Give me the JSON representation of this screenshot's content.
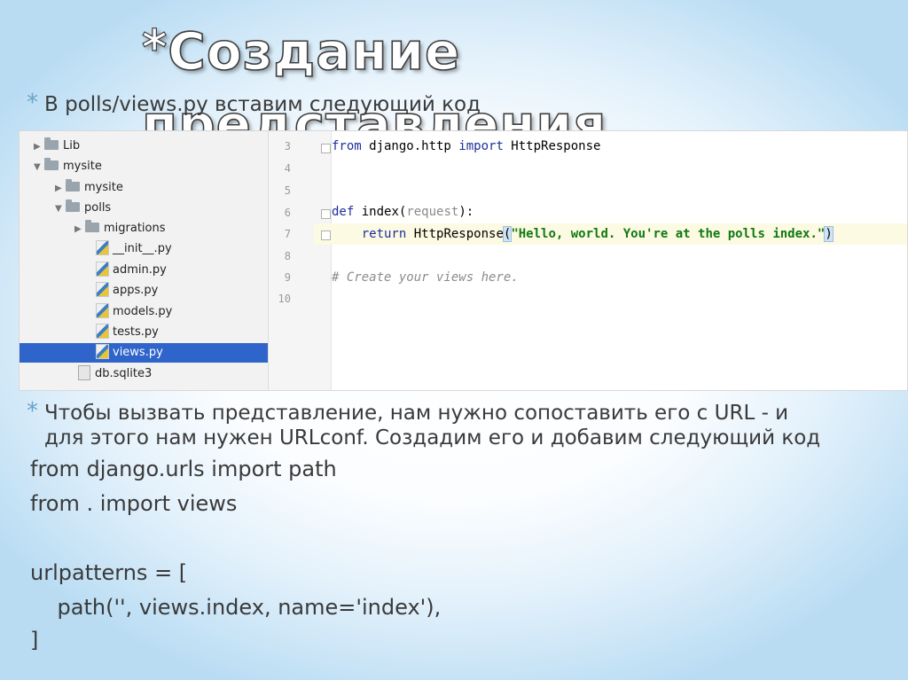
{
  "slide": {
    "title": "Создание представления",
    "title_star": "*",
    "bullet1": "В polls/views.py вставим следующий код",
    "bullet2_line1": "Чтобы вызвать представление, нам нужно сопоставить его с URL - и",
    "bullet2_line2": "для этого нам нужен URLconf. Создадим его и добавим следующий код",
    "bullet_star": "*",
    "code_lines": [
      "from django.urls import path",
      "from . import views",
      "",
      "urlpatterns = [",
      "    path('', views.index, name='index'),",
      "]"
    ]
  },
  "ide": {
    "tree": [
      {
        "label": "Lib",
        "arrow": "▶",
        "icon": "folder-icon",
        "depth": 0
      },
      {
        "label": "mysite",
        "arrow": "▼",
        "icon": "folder-icon",
        "depth": 0
      },
      {
        "label": "mysite",
        "arrow": "▶",
        "icon": "folder-icon",
        "depth": 1
      },
      {
        "label": "polls",
        "arrow": "▼",
        "icon": "folder-icon",
        "depth": 1
      },
      {
        "label": "migrations",
        "arrow": "▶",
        "icon": "folder-icon",
        "depth": 2
      },
      {
        "label": "__init__.py",
        "arrow": "",
        "icon": "python-file-icon",
        "depth": 2
      },
      {
        "label": "admin.py",
        "arrow": "",
        "icon": "python-file-icon",
        "depth": 2
      },
      {
        "label": "apps.py",
        "arrow": "",
        "icon": "python-file-icon",
        "depth": 2
      },
      {
        "label": "models.py",
        "arrow": "",
        "icon": "python-file-icon",
        "depth": 2
      },
      {
        "label": "tests.py",
        "arrow": "",
        "icon": "python-file-icon",
        "depth": 2
      },
      {
        "label": "views.py",
        "arrow": "",
        "icon": "python-file-icon",
        "depth": 2,
        "selected": true
      },
      {
        "label": "db.sqlite3",
        "arrow": "",
        "icon": "database-file-icon",
        "depth": 1
      }
    ],
    "line_numbers": [
      "3",
      "4",
      "5",
      "6",
      "7",
      "8",
      "9",
      "10"
    ],
    "code": {
      "l3_kw1": "from",
      "l3_mod": " django.http ",
      "l3_kw2": "import",
      "l3_name": " HttpResponse",
      "l6_kw": "def",
      "l6_fn": " index(",
      "l6_param": "request",
      "l6_end": "):",
      "l7_indent": "    ",
      "l7_kw": "return",
      "l7_call": " HttpResponse",
      "l7_open": "(",
      "l7_str": "\"Hello, world. You're at the polls index.\"",
      "l7_close": ")",
      "l9_comment": "# Create your views here."
    },
    "colors": {
      "keyword": "#1f2e9e",
      "string": "#117911",
      "selection": "#2f65ca",
      "current_line": "#fcfae2"
    }
  }
}
